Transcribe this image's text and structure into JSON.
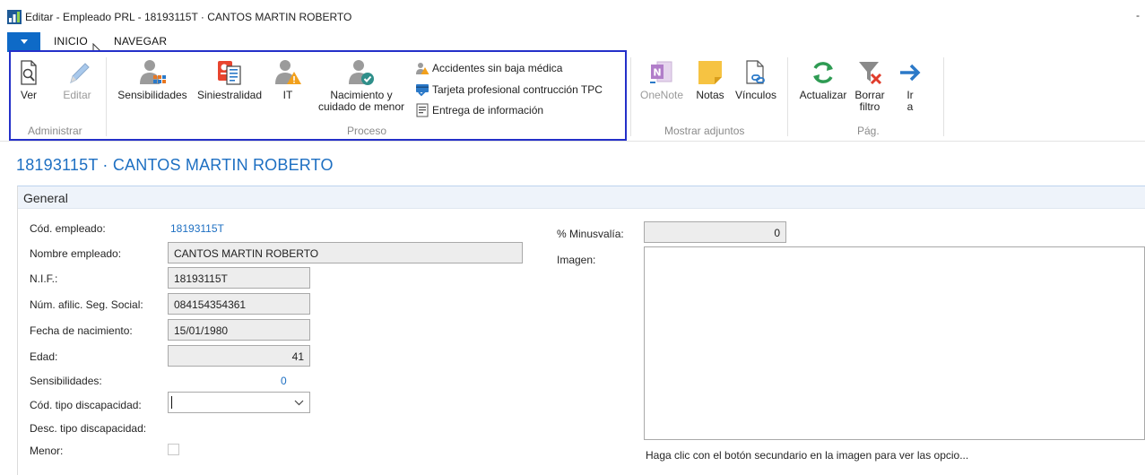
{
  "window": {
    "title": "Editar - Empleado PRL - 18193115T · CANTOS MARTIN ROBERTO",
    "minimize": "-"
  },
  "tabs": {
    "inicio": "INICIO",
    "navegar": "NAVEGAR"
  },
  "ribbon": {
    "administrar": {
      "label": "Administrar",
      "ver": "Ver",
      "editar": "Editar"
    },
    "proceso": {
      "label": "Proceso",
      "sensibilidades": "Sensibilidades",
      "siniestralidad": "Siniestralidad",
      "it": "IT",
      "nacimiento_l1": "Nacimiento y",
      "nacimiento_l2": "cuidado de menor",
      "accidentes": "Accidentes sin baja médica",
      "tarjeta": "Tarjeta profesional contrucción TPC",
      "entrega": "Entrega de información"
    },
    "mostrar_adjuntos": {
      "label": "Mostrar adjuntos",
      "onenote": "OneNote",
      "notas": "Notas",
      "vinculos": "Vínculos"
    },
    "pag": {
      "label": "Pág.",
      "actualizar": "Actualizar",
      "borrar_l1": "Borrar",
      "borrar_l2": "filtro",
      "ir_l1": "Ir",
      "ir_l2": "a"
    }
  },
  "page_title": "18193115T · CANTOS MARTIN ROBERTO",
  "general": {
    "header": "General",
    "cod_empleado_label": "Cód. empleado:",
    "cod_empleado_value": "18193115T",
    "nombre_label": "Nombre empleado:",
    "nombre_value": "CANTOS MARTIN ROBERTO",
    "nif_label": "N.I.F.:",
    "nif_value": "18193115T",
    "afiliacion_label": "Núm. afilic. Seg. Social:",
    "afiliacion_value": "084154354361",
    "nacimiento_label": "Fecha de nacimiento:",
    "nacimiento_value": "15/01/1980",
    "edad_label": "Edad:",
    "edad_value": "41",
    "sensibilidades_label": "Sensibilidades:",
    "sensibilidades_value": "0",
    "tipo_disc_label": "Cód. tipo discapacidad:",
    "tipo_disc_value": "",
    "desc_disc_label": "Desc. tipo discapacidad:",
    "menor_label": "Menor:",
    "minusvalia_label": "% Minusvalía:",
    "minusvalia_value": "0",
    "imagen_label": "Imagen:",
    "imagen_hint": "Haga clic con el botón secundario en la imagen para ver las opcio..."
  },
  "colors": {
    "accent": "#1d6fc2",
    "file_tab": "#0e6ac7",
    "selection_border": "#2430c9"
  }
}
